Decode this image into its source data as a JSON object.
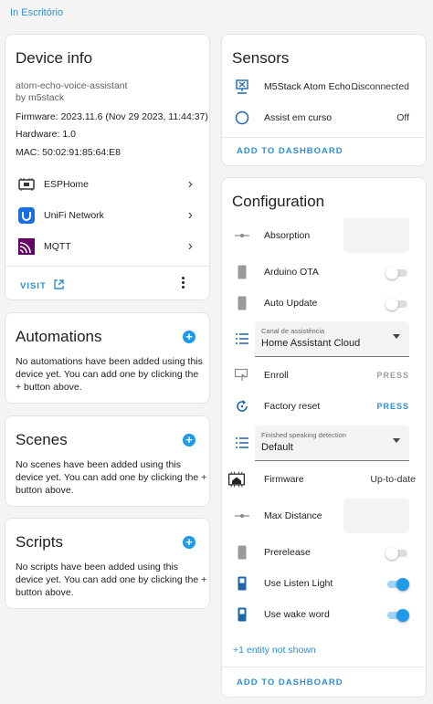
{
  "breadcrumb": "In Escritório",
  "device_info": {
    "title": "Device info",
    "model": "atom-echo-voice-assistant",
    "manufacturer": "by m5stack",
    "firmware": "Firmware: 2023.11.6 (Nov 29 2023, 11:44:37)",
    "hardware": "Hardware: 1.0",
    "mac": "MAC: 50:02:91:85:64:E8",
    "integrations": [
      {
        "label": "ESPHome",
        "icon": "esphome-icon"
      },
      {
        "label": "UniFi Network",
        "icon": "unifi-icon"
      },
      {
        "label": "MQTT",
        "icon": "mqtt-icon"
      }
    ],
    "visit_label": "VISIT"
  },
  "automations": {
    "title": "Automations",
    "text": "No automations have been added using this device yet. You can add one by clicking the + button above."
  },
  "scenes": {
    "title": "Scenes",
    "text": "No scenes have been added using this device yet. You can add one by clicking the + button above."
  },
  "scripts": {
    "title": "Scripts",
    "text": "No scripts have been added using this device yet. You can add one by clicking the + button above."
  },
  "sensors": {
    "title": "Sensors",
    "rows": [
      {
        "label": "M5Stack Atom Echo ...",
        "state": "Disconnected",
        "icon": "network-icon"
      },
      {
        "label": "Assist em curso",
        "state": "Off",
        "icon": "circle-outline-icon"
      }
    ],
    "add_label": "ADD TO DASHBOARD"
  },
  "configuration": {
    "title": "Configuration",
    "absorption": "Absorption",
    "arduino_ota": "Arduino OTA",
    "arduino_ota_on": false,
    "auto_update": "Auto Update",
    "auto_update_on": false,
    "pipeline_label": "Canal de assistência",
    "pipeline_value": "Home Assistant Cloud",
    "enroll": "Enroll",
    "enroll_action": "PRESS",
    "factory_reset": "Factory reset",
    "factory_reset_action": "PRESS",
    "finished_label": "Finished speaking detection",
    "finished_value": "Default",
    "firmware": "Firmware",
    "firmware_state": "Up-to-date",
    "max_distance": "Max Distance",
    "prerelease": "Prerelease",
    "prerelease_on": false,
    "listen_light": "Use Listen Light",
    "listen_light_on": true,
    "wake_word": "Use wake word",
    "wake_word_on": true,
    "hidden": "+1 entity not shown",
    "add_label": "ADD TO DASHBOARD"
  },
  "colors": {
    "accent": "#1e9be8",
    "link": "#2f8fd1",
    "background": "#f4f4f5"
  }
}
